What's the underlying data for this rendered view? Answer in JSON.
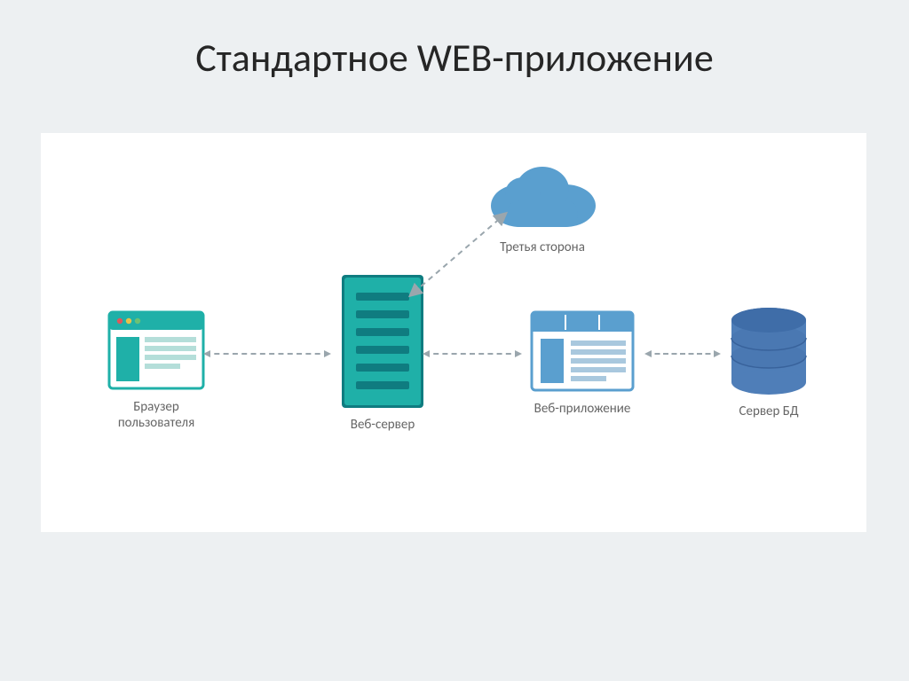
{
  "slide": {
    "title": "Стандартное WEB-приложение"
  },
  "nodes": {
    "browser": {
      "label_line1": "Браузер",
      "label_line2": "пользователя"
    },
    "server": {
      "label": "Веб-сервер"
    },
    "cloud": {
      "label": "Третья сторона"
    },
    "webapp": {
      "label": "Веб-приложение"
    },
    "db": {
      "label": "Сервер БД"
    }
  },
  "colors": {
    "teal": "#1fb0a8",
    "blue": "#5a9fcf",
    "blue_dark": "#3f6da8",
    "gray_line": "#9aa6ad",
    "label": "#666666"
  }
}
